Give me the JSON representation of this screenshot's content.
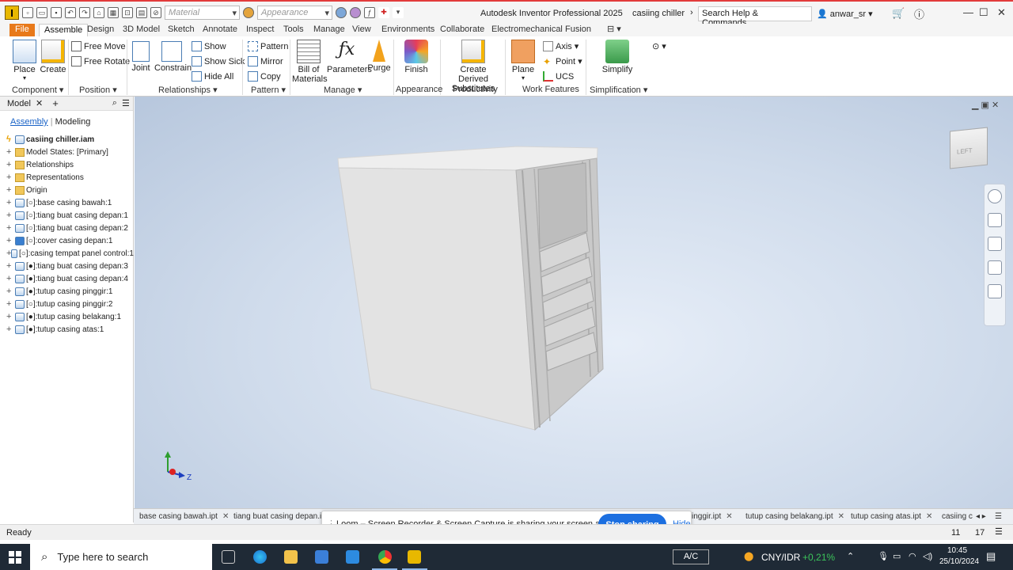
{
  "titlebar": {
    "logo": "I",
    "material_placeholder": "Material",
    "appearance_placeholder": "Appearance",
    "app_title": "Autodesk Inventor Professional 2025",
    "doc_title": "casiing chiller",
    "search_placeholder": "Search Help & Commands...",
    "user": "anwar_sr"
  },
  "menu": {
    "tabs": [
      "File",
      "Assemble",
      "Design",
      "3D Model",
      "Sketch",
      "Annotate",
      "Inspect",
      "Tools",
      "Manage",
      "View",
      "Environments",
      "Collaborate",
      "Electromechanical",
      "Fusion"
    ]
  },
  "ribbon": {
    "place": "Place",
    "create": "Create",
    "free_move": "Free Move",
    "free_rotate": "Free Rotate",
    "joint": "Joint",
    "constrain": "Constrain",
    "show": "Show",
    "show_sick": "Show Sick",
    "hide_all": "Hide All",
    "pattern": "Pattern",
    "mirror": "Mirror",
    "copy": "Copy",
    "bill_of_materials_1": "Bill of",
    "bill_of_materials_2": "Materials",
    "parameters": "Parameters",
    "purge": "Purge",
    "finish": "Finish",
    "create_derived_1": "Create Derived",
    "create_derived_2": "Substitutes",
    "plane": "Plane",
    "axis": "Axis",
    "point": "Point",
    "ucs": "UCS",
    "simplify": "Simplify",
    "groups": {
      "component": "Component",
      "position": "Position",
      "relationships": "Relationships",
      "pattern": "Pattern",
      "manage": "Manage",
      "appearance": "Appearance",
      "productivity": "Productivity",
      "work_features": "Work Features",
      "simplification": "Simplification"
    }
  },
  "browser": {
    "title": "Model",
    "tab_assembly": "Assembly",
    "tab_modeling": "Modeling",
    "root": "casiing chiller.iam",
    "items": [
      "Model States: [Primary]",
      "Relationships",
      "Representations",
      "Origin",
      "[○]:base casing bawah:1",
      "[○]:tiang buat casing depan:1",
      "[○]:tiang buat casing depan:2",
      "[○]:cover casing depan:1",
      "[○]:casing tempat panel control:1",
      "[●]:tiang buat casing depan:3",
      "[●]:tiang buat casing depan:4",
      "[●]:tutup casing pinggir:1",
      "[○]:tutup casing pinggir:2",
      "[●]:tutup casing belakang:1",
      "[●]:tutup casing atas:1"
    ]
  },
  "viewcube": {
    "face": "LEFT"
  },
  "triad": {
    "z": "Z"
  },
  "doctabs": [
    "base casing bawah.ipt",
    "tiang buat casing depan.i",
    "inggir.ipt",
    "tutup casing belakang.ipt",
    "tutup casing atas.ipt",
    "casiing c"
  ],
  "loom": {
    "message": "Loom – Screen Recorder & Screen Capture is sharing your screen and audio.",
    "stop": "Stop sharing",
    "hide": "Hide"
  },
  "status": {
    "text": "Ready",
    "n1": "11",
    "n2": "17"
  },
  "taskbar": {
    "search": "Type here to search",
    "ac": "A/C",
    "currency": "CNY/IDR",
    "change": "+0,21%",
    "time": "10:45",
    "date": "25/10/2024"
  },
  "colors": {
    "file_tab": "#e8791a",
    "accent": "#1c6fe0",
    "positive": "#3cc45a"
  }
}
